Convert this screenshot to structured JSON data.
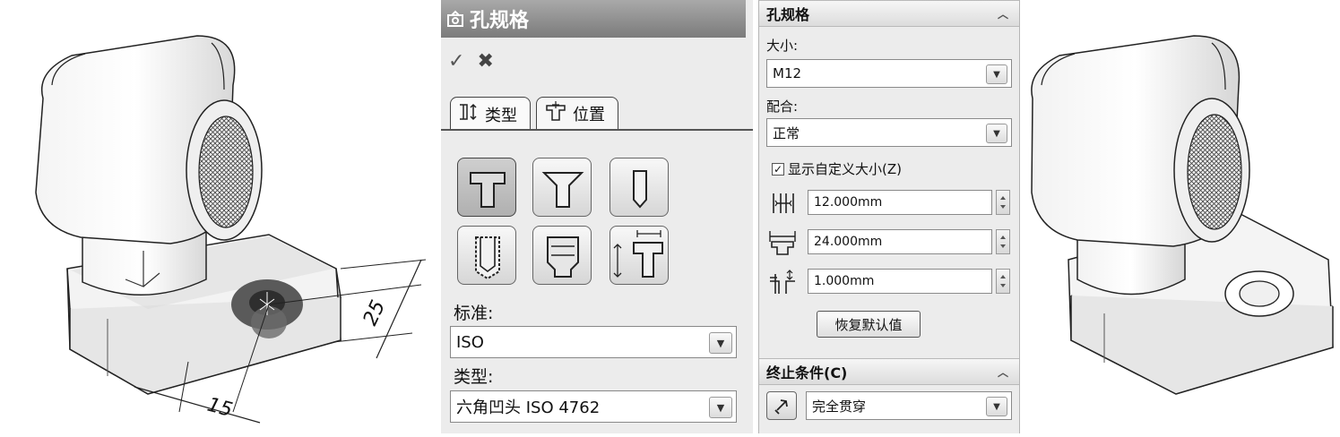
{
  "left_model": {
    "dim_horizontal": "15",
    "dim_vertical": "25"
  },
  "hole_panel": {
    "title": "孔规格",
    "ok_glyph": "✓",
    "cancel_glyph": "✖",
    "tabs": [
      {
        "label": "类型",
        "active": true
      },
      {
        "label": "位置",
        "active": false
      }
    ],
    "hole_types": [
      {
        "icon": "counterbore-icon",
        "selected": true
      },
      {
        "icon": "countersink-icon",
        "selected": false
      },
      {
        "icon": "simple-hole-icon",
        "selected": false
      },
      {
        "icon": "tapped-hole-icon",
        "selected": false
      },
      {
        "icon": "pipe-tap-icon",
        "selected": false
      },
      {
        "icon": "legacy-hole-icon",
        "selected": false
      }
    ],
    "standard_label": "标准:",
    "standard_value": "ISO",
    "type_label": "类型:",
    "type_value": "六角凹头 ISO 4762"
  },
  "spec_panel": {
    "section_title": "孔规格",
    "size_label": "大小:",
    "size_value": "M12",
    "fit_label": "配合:",
    "fit_value": "正常",
    "show_custom_size": {
      "checked": true,
      "label": "显示自定义大小(Z)"
    },
    "fields": [
      {
        "icon": "through-hole-diameter-icon",
        "value": "12.000mm"
      },
      {
        "icon": "counterbore-diameter-icon",
        "value": "24.000mm"
      },
      {
        "icon": "counterbore-depth-icon",
        "value": "1.000mm"
      }
    ],
    "restore_label": "恢复默认值",
    "end_condition_title": "终止条件(C)",
    "end_condition_value": "完全贯穿"
  },
  "colors": {
    "panel_bg": "#ececec",
    "titlebar": "#8a8a8a",
    "accent": "#555555"
  }
}
